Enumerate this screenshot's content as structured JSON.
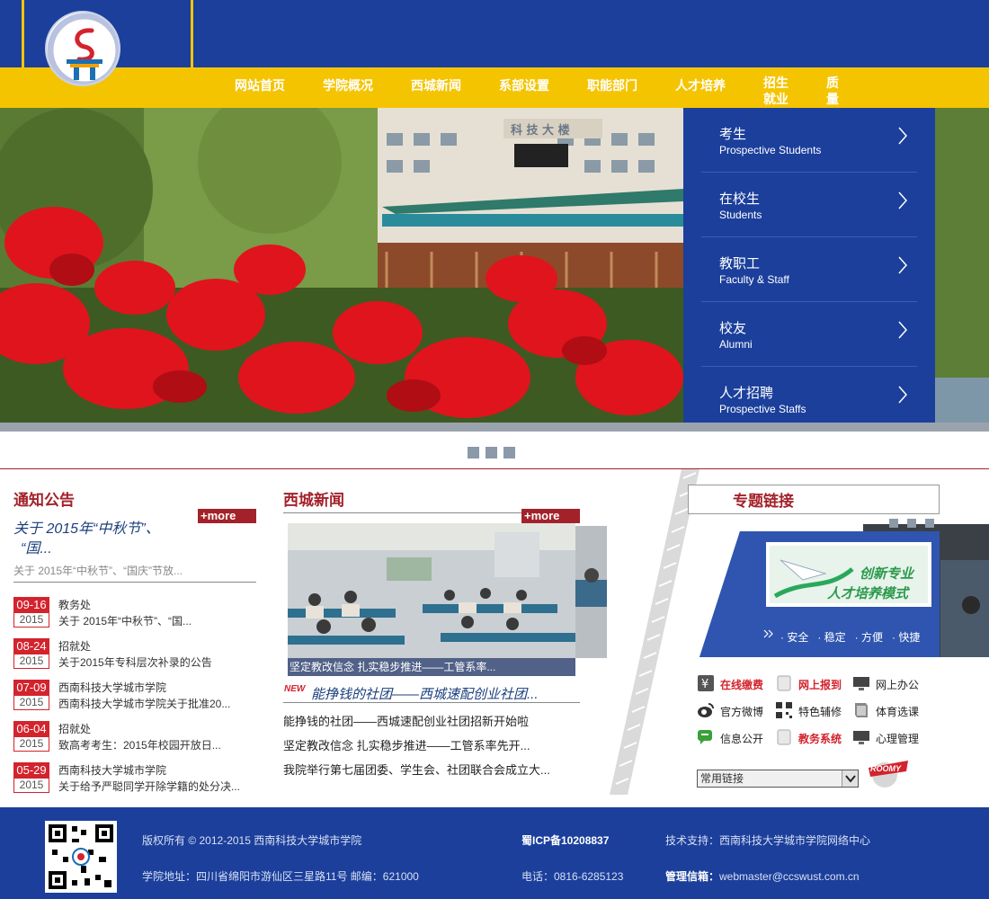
{
  "nav": {
    "items": [
      "网站首页",
      "学院概况",
      "西城新闻",
      "系部设置",
      "职能部门",
      "人才培养"
    ],
    "narrow_items": [
      "招生就业",
      "质量工程"
    ]
  },
  "banner": {
    "building_sign": "科 技 大 楼"
  },
  "side_menu": [
    {
      "cn": "考生",
      "en": "Prospective Students"
    },
    {
      "cn": "在校生",
      "en": "Students"
    },
    {
      "cn": "教职工",
      "en": "Faculty & Staff"
    },
    {
      "cn": "校友",
      "en": "Alumni"
    },
    {
      "cn": "人才招聘",
      "en": "Prospective Staffs"
    }
  ],
  "notices": {
    "title": "通知公告",
    "more": "+more",
    "featured_title_1": "关于 2015年“中秋节”、",
    "featured_title_2": "“国...",
    "featured_sub": "关于 2015年“中秋节”、“国庆”节放...",
    "items": [
      {
        "md": "09-16",
        "year": "2015",
        "source": "教务处",
        "text": "关于 2015年“中秋节”、“国..."
      },
      {
        "md": "08-24",
        "year": "2015",
        "source": "招就处",
        "text": "关于2015年专科层次补录的公告"
      },
      {
        "md": "07-09",
        "year": "2015",
        "source": "西南科技大学城市学院",
        "text": "西南科技大学城市学院关于批准20..."
      },
      {
        "md": "06-04",
        "year": "2015",
        "source": "招就处",
        "text": "致高考考生：2015年校园开放日..."
      },
      {
        "md": "05-29",
        "year": "2015",
        "source": "西南科技大学城市学院",
        "text": "关于给予严聪同学开除学籍的处分决..."
      }
    ]
  },
  "news": {
    "title": "西城新闻",
    "more": "+more",
    "photo_caption": "坚定教改信念 扎实稳步推进——工管系率...",
    "new_badge": "NEW",
    "headline": "能挣钱的社团——西城速配创业社团...",
    "items": [
      "能挣钱的社团——西城速配创业社团招新开始啦",
      "坚定教改信念 扎实稳步推进——工管系率先开...",
      "我院举行第七届团委、学生会、社团联合会成立大..."
    ]
  },
  "topics": {
    "title": "专题链接",
    "slide_heading_1": "创新专业",
    "slide_heading_2": "人才培养模式",
    "slide_tags": "· 安全   · 稳定   · 方便   · 快捷",
    "quick_links": [
      {
        "label": "在线缴费",
        "color": "#d3232d",
        "bold": true,
        "icon": "yen-icon"
      },
      {
        "label": "网上报到",
        "color": "#d3232d",
        "bold": true,
        "icon": "document-icon"
      },
      {
        "label": "网上办公",
        "color": "#222222",
        "bold": false,
        "icon": "monitor-icon"
      },
      {
        "label": "官方微博",
        "color": "#222222",
        "bold": false,
        "icon": "weibo-icon"
      },
      {
        "label": "特色辅修",
        "color": "#222222",
        "bold": false,
        "icon": "qrcode-icon"
      },
      {
        "label": "体育选课",
        "color": "#222222",
        "bold": false,
        "icon": "book-icon"
      },
      {
        "label": "信息公开",
        "color": "#222222",
        "bold": false,
        "icon": "chat-icon"
      },
      {
        "label": "教务系统",
        "color": "#d3232d",
        "bold": true,
        "icon": "document-icon"
      },
      {
        "label": "心理管理",
        "color": "#222222",
        "bold": false,
        "icon": "monitor-icon"
      }
    ],
    "select_value": "常用链接",
    "roomy_logo": "ROOMY"
  },
  "footer": {
    "copyright": "版权所有 © 2012-2015 西南科技大学城市学院",
    "icp": "蜀ICP备10208837",
    "tech": "技术支持：西南科技大学城市学院网络中心",
    "address": "学院地址：四川省绵阳市游仙区三星路11号 邮编：621000",
    "phone": "电话：0816-6285123",
    "mail_label": "管理信箱：",
    "mail": "webmaster@ccswust.com.cn"
  },
  "colors": {
    "brand_blue": "#1b3f9b",
    "nav_yellow": "#f5c400",
    "accent_red": "#a3222a",
    "date_red": "#d3232d"
  }
}
